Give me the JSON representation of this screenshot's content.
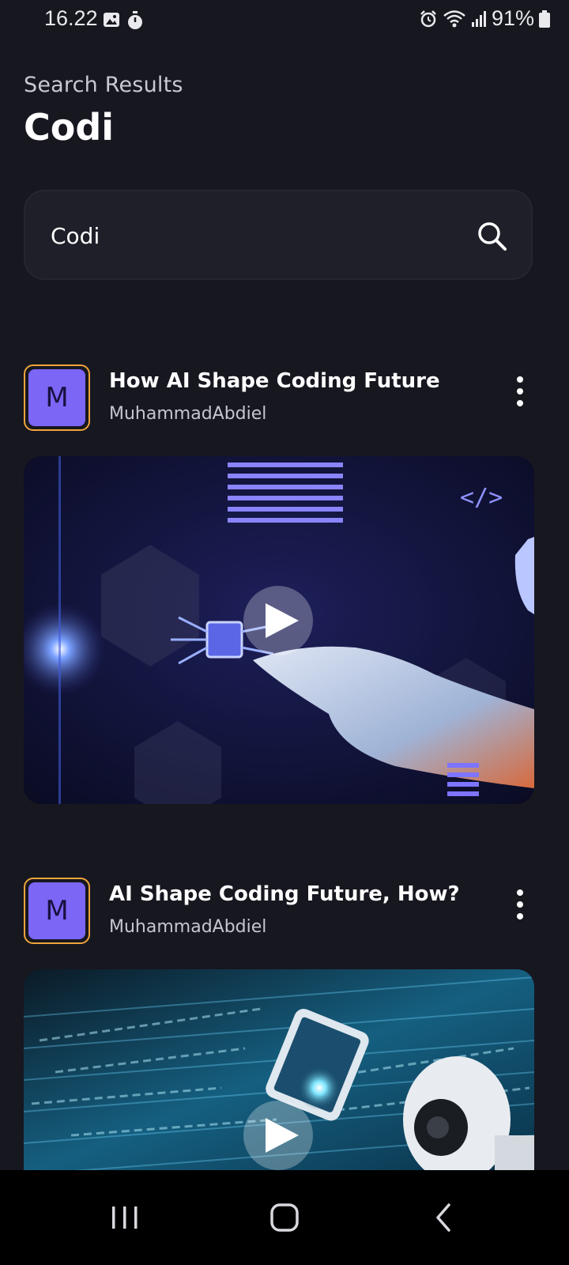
{
  "status_bar": {
    "time": "16.22",
    "battery": "91%",
    "left_icons": [
      "image-icon",
      "timer-icon"
    ],
    "right_icons": [
      "alarm-icon",
      "wifi-icon",
      "signal-icon",
      "battery-icon"
    ]
  },
  "header": {
    "subtitle": "Search Results",
    "title": "Codi"
  },
  "search": {
    "value": "Codi",
    "icon": "search-icon"
  },
  "results": [
    {
      "avatar_letter": "M",
      "title": "How AI Shape Coding Future",
      "author": "MuhammadAbdiel"
    },
    {
      "avatar_letter": "M",
      "title": "AI Shape Coding Future, How?",
      "author": "MuhammadAbdiel"
    }
  ],
  "colors": {
    "background": "#171720",
    "search_bg": "#1f1f29",
    "avatar_bg": "#7b66f5",
    "avatar_border": "#f0a43a"
  },
  "nav_icons": [
    "recents-icon",
    "home-icon",
    "back-icon"
  ]
}
